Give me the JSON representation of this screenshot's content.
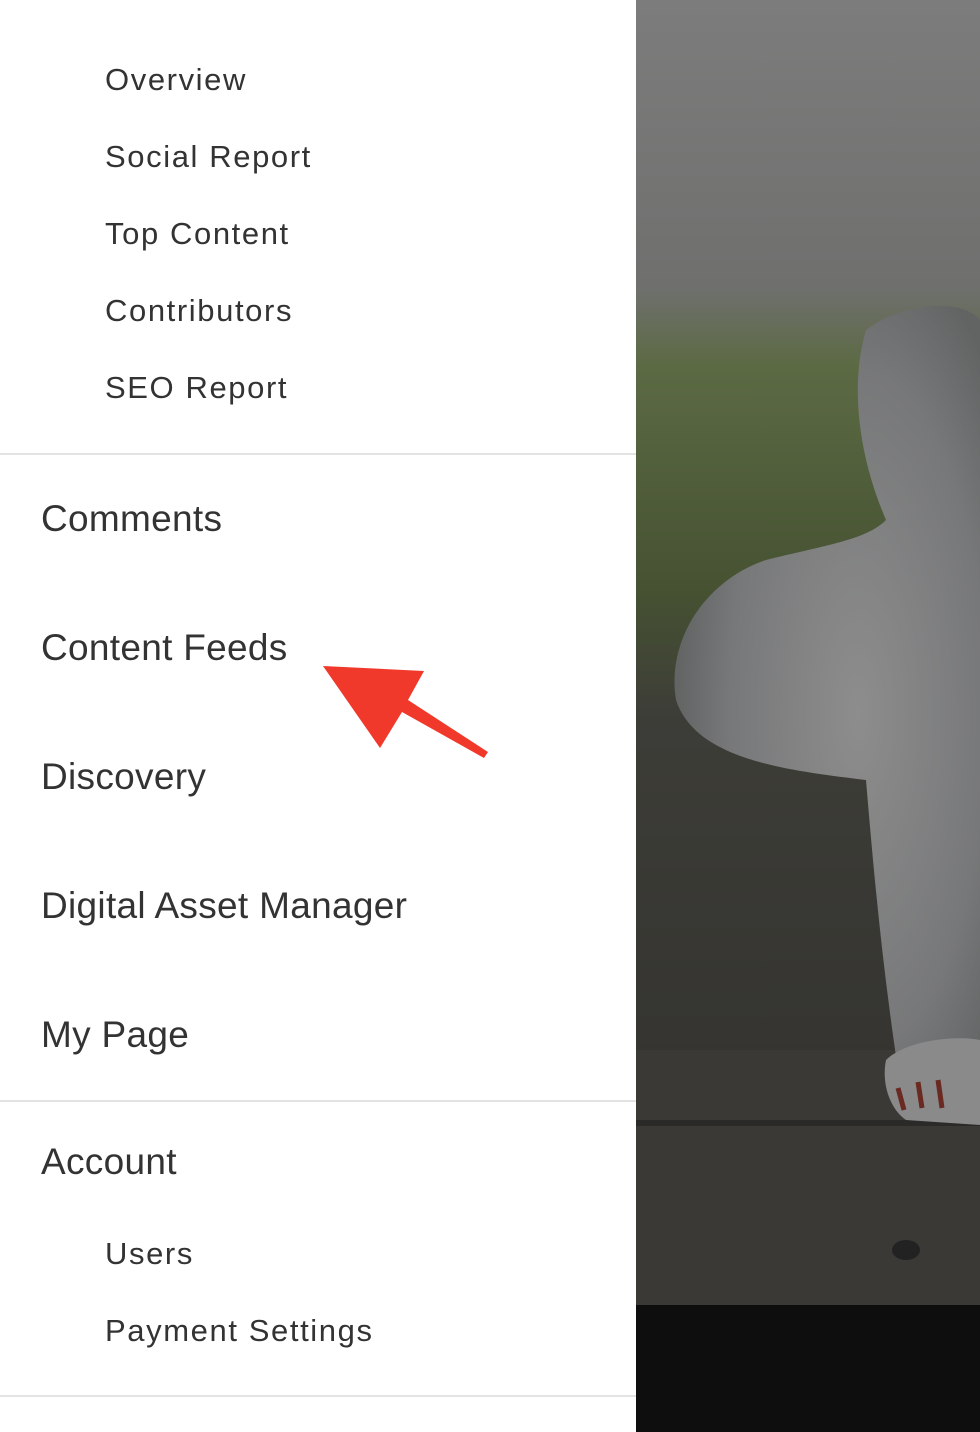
{
  "nav": {
    "sub_items_top": [
      "Overview",
      "Social Report",
      "Top Content",
      "Contributors",
      "SEO Report"
    ],
    "main_items": [
      "Comments",
      "Content Feeds",
      "Discovery",
      "Digital Asset Manager",
      "My Page"
    ],
    "account_heading": "Account",
    "account_items": [
      "Users",
      "Payment Settings"
    ]
  },
  "annotation": {
    "arrow_color": "#f0392b",
    "target_label": "Content Feeds"
  },
  "colors": {
    "text": "#333333",
    "divider": "#e3e3e3",
    "backdrop": "#101010"
  }
}
